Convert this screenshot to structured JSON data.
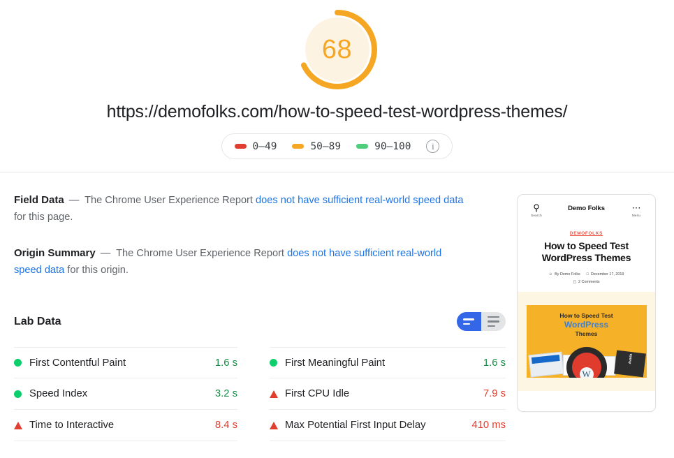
{
  "report": {
    "score": "68",
    "score_color": "#f5a623",
    "score_percent": 68,
    "url": "https://demofolks.com/how-to-speed-test-wordpress-themes/"
  },
  "legend": {
    "items": [
      {
        "range": "0–49",
        "color": "#e03e2e",
        "name": "legend-red"
      },
      {
        "range": "50–89",
        "color": "#f5a623",
        "name": "legend-orange"
      },
      {
        "range": "90–100",
        "color": "#4ecd7b",
        "name": "legend-green"
      }
    ],
    "info_glyph": "i"
  },
  "field_data": {
    "label": "Field Data",
    "dash": "—",
    "text_before": "The Chrome User Experience Report",
    "link": "does not have sufficient real-world speed data",
    "text_after": "for this page."
  },
  "origin_summary": {
    "label": "Origin Summary",
    "dash": "—",
    "text_before": "The Chrome User Experience Report",
    "link": "does not have sufficient real-world speed data",
    "text_after": "for this origin."
  },
  "lab_data": {
    "title": "Lab Data",
    "view_toggle": {
      "active": "compact-view",
      "options": [
        "compact-view",
        "detailed-view"
      ]
    },
    "metrics_left": [
      {
        "label": "First Contentful Paint",
        "value": "1.6 s",
        "status": "pass",
        "color": "#178c46",
        "icon": "circle"
      },
      {
        "label": "Speed Index",
        "value": "3.2 s",
        "status": "pass",
        "color": "#178c46",
        "icon": "circle"
      },
      {
        "label": "Time to Interactive",
        "value": "8.4 s",
        "status": "fail",
        "color": "#e03e2e",
        "icon": "triangle"
      }
    ],
    "metrics_right": [
      {
        "label": "First Meaningful Paint",
        "value": "1.6 s",
        "status": "pass",
        "color": "#178c46",
        "icon": "circle"
      },
      {
        "label": "First CPU Idle",
        "value": "7.9 s",
        "status": "fail",
        "color": "#e03e2e",
        "icon": "triangle"
      },
      {
        "label": "Max Potential First Input Delay",
        "value": "410 ms",
        "status": "fail",
        "color": "#e03e2e",
        "icon": "triangle"
      }
    ],
    "icon_colors": {
      "pass": "#0cce6b",
      "fail": "#e03e2e"
    }
  },
  "thumbnail": {
    "search_label": "Search",
    "menu_label": "Menu",
    "brand": "Demo Folks",
    "category": "DEMOFOLKS",
    "title_line1": "How to Speed Test",
    "title_line2": "WordPress Themes",
    "author": "By Demo Folks",
    "date": "December 17, 2019",
    "comments": "2 Comments",
    "hero_line1": "How to Speed Test",
    "hero_line2": "WordPress",
    "hero_line3": "Themes"
  }
}
